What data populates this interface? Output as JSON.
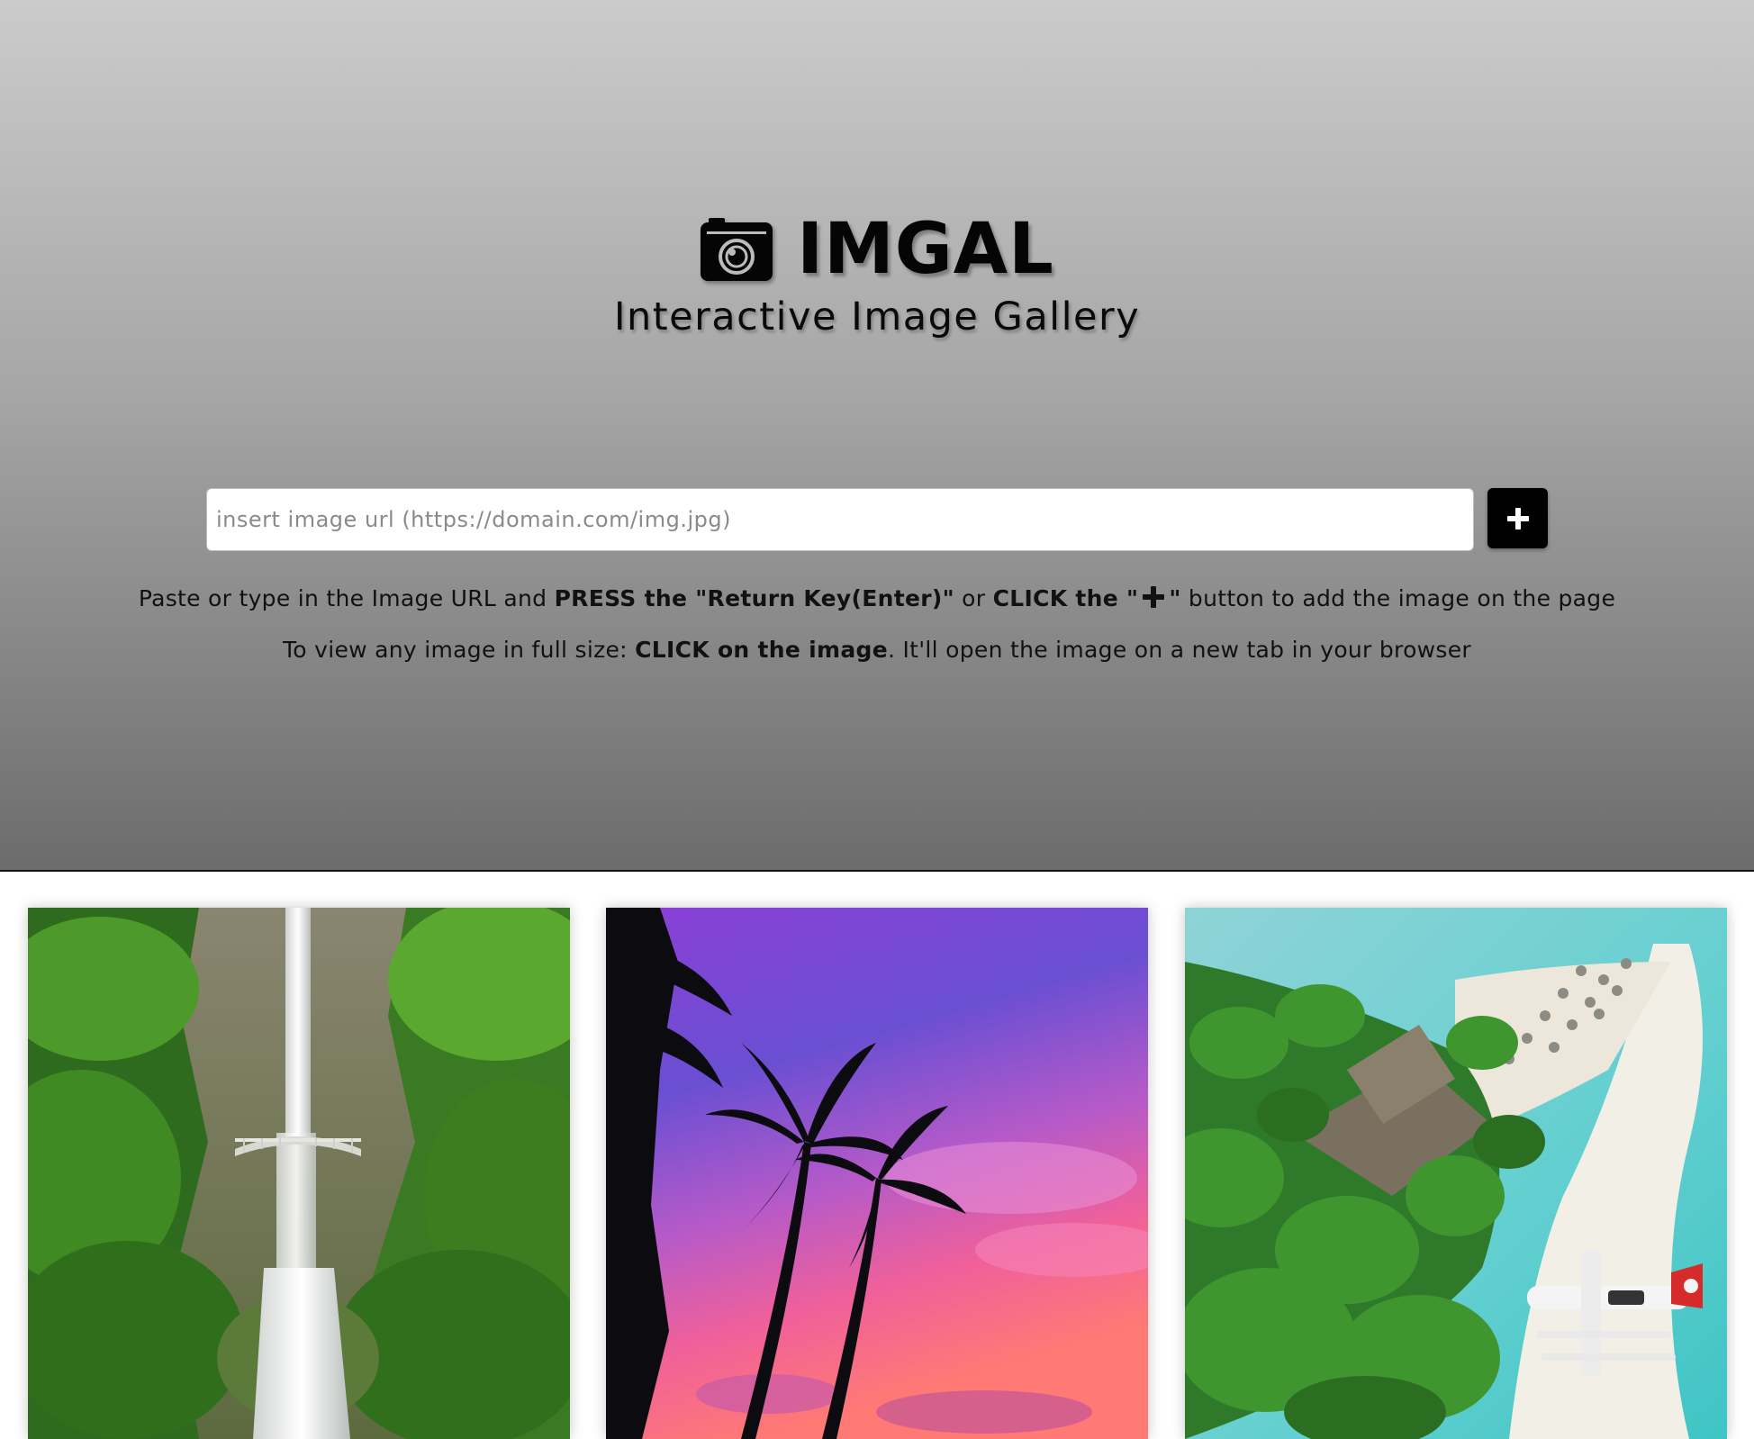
{
  "header": {
    "brand_icon": "camera-icon",
    "title": "IMGAL",
    "subtitle": "Interactive Image Gallery"
  },
  "form": {
    "url_placeholder": "insert image url (https://domain.com/img.jpg)",
    "url_value": "",
    "add_button_icon": "plus-icon"
  },
  "instructions": {
    "line1_part1": "Paste or type in the Image URL and ",
    "line1_bold1": "PRESS the \"Return Key(Enter)\"",
    "line1_part2": " or ",
    "line1_bold2_start": "CLICK the \"",
    "line1_bold2_end": "\"",
    "line1_part3": " button to add the image on the page",
    "line2_part1": "To view any image in full size: ",
    "line2_bold": "CLICK on the image",
    "line2_part2": ". It'll open the image on a new tab in your browser"
  },
  "gallery": {
    "images": [
      {
        "subject": "waterfall-with-bridge-photo"
      },
      {
        "subject": "palm-trees-sunset-photo"
      },
      {
        "subject": "tropical-beach-seaplane-photo"
      }
    ]
  },
  "colors": {
    "hero_top": "#cbcbcb",
    "hero_bottom": "#6c6c6c",
    "button": "#000000",
    "text": "#111111"
  }
}
